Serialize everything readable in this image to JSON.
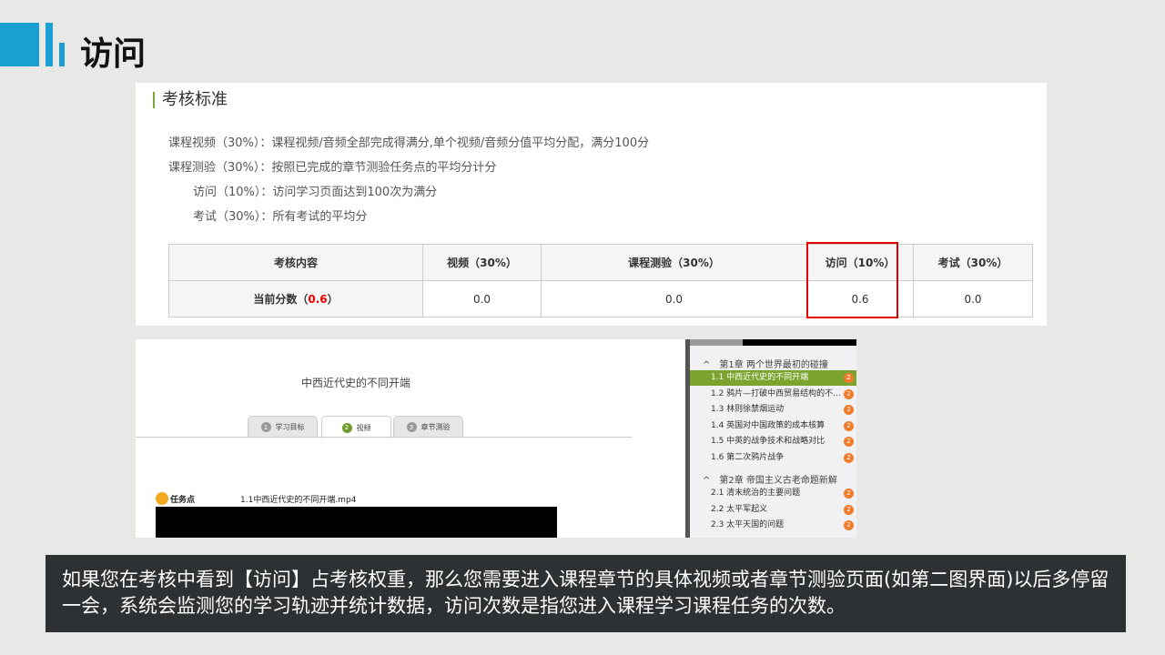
{
  "slide": {
    "title": "访问",
    "accent_color": "#1a9fd2"
  },
  "criteria": {
    "heading": "考核标准",
    "rules": [
      "课程视频（30%）：课程视频/音频全部完成得满分,单个视频/音频分值平均分配，满分100分",
      "课程测验（30%）：按照已完成的章节测验任务点的平均分计分",
      "访问（10%）：访问学习页面达到100次为满分",
      "考试（30%）：所有考试的平均分"
    ],
    "table": {
      "headers": [
        "考核内容",
        "视频（30%）",
        "课程测验（30%）",
        "访问（10%）",
        "考试（30%）"
      ],
      "row_label": "当前分数（",
      "row_value": "0.6",
      "row_label_end": "）",
      "values": [
        "0.0",
        "0.0",
        "0.6",
        "0.0"
      ]
    },
    "highlight_color": "#e10000"
  },
  "video_page": {
    "title": "中西近代史的不同开端",
    "tabs": [
      {
        "num": "1",
        "label": "学习目标"
      },
      {
        "num": "2",
        "label": "视频"
      },
      {
        "num": "3",
        "label": "章节测验"
      }
    ],
    "task_label": "任务点",
    "file": "1.1中西近代史的不同开端.mp4"
  },
  "sidebar": {
    "chapters": [
      {
        "title": "第1章 两个世界最初的碰撞",
        "items": [
          "1.1 中西近代史的不同开端",
          "1.2 鸦片—打破中西贸易结构的不...",
          "1.3 林则徐禁烟运动",
          "1.4 英国对中国政策的成本核算",
          "1.5 中英的战争技术和战略对比",
          "1.6 第二次鸦片战争"
        ]
      },
      {
        "title": "第2章 帝国主义古老命题新解",
        "items": [
          "2.1 清末统治的主要问题",
          "2.2 太平军起义",
          "2.3 太平天国的问题"
        ]
      }
    ],
    "badge": "2",
    "chevron": "^"
  },
  "note": "如果您在考核中看到【访问】占考核权重，那么您需要进入课程章节的具体视频或者章节测验页面(如第二图界面)以后多停留一会，系统会监测您的学习轨迹并统计数据，访问次数是指您进入课程学习课程任务的次数。"
}
